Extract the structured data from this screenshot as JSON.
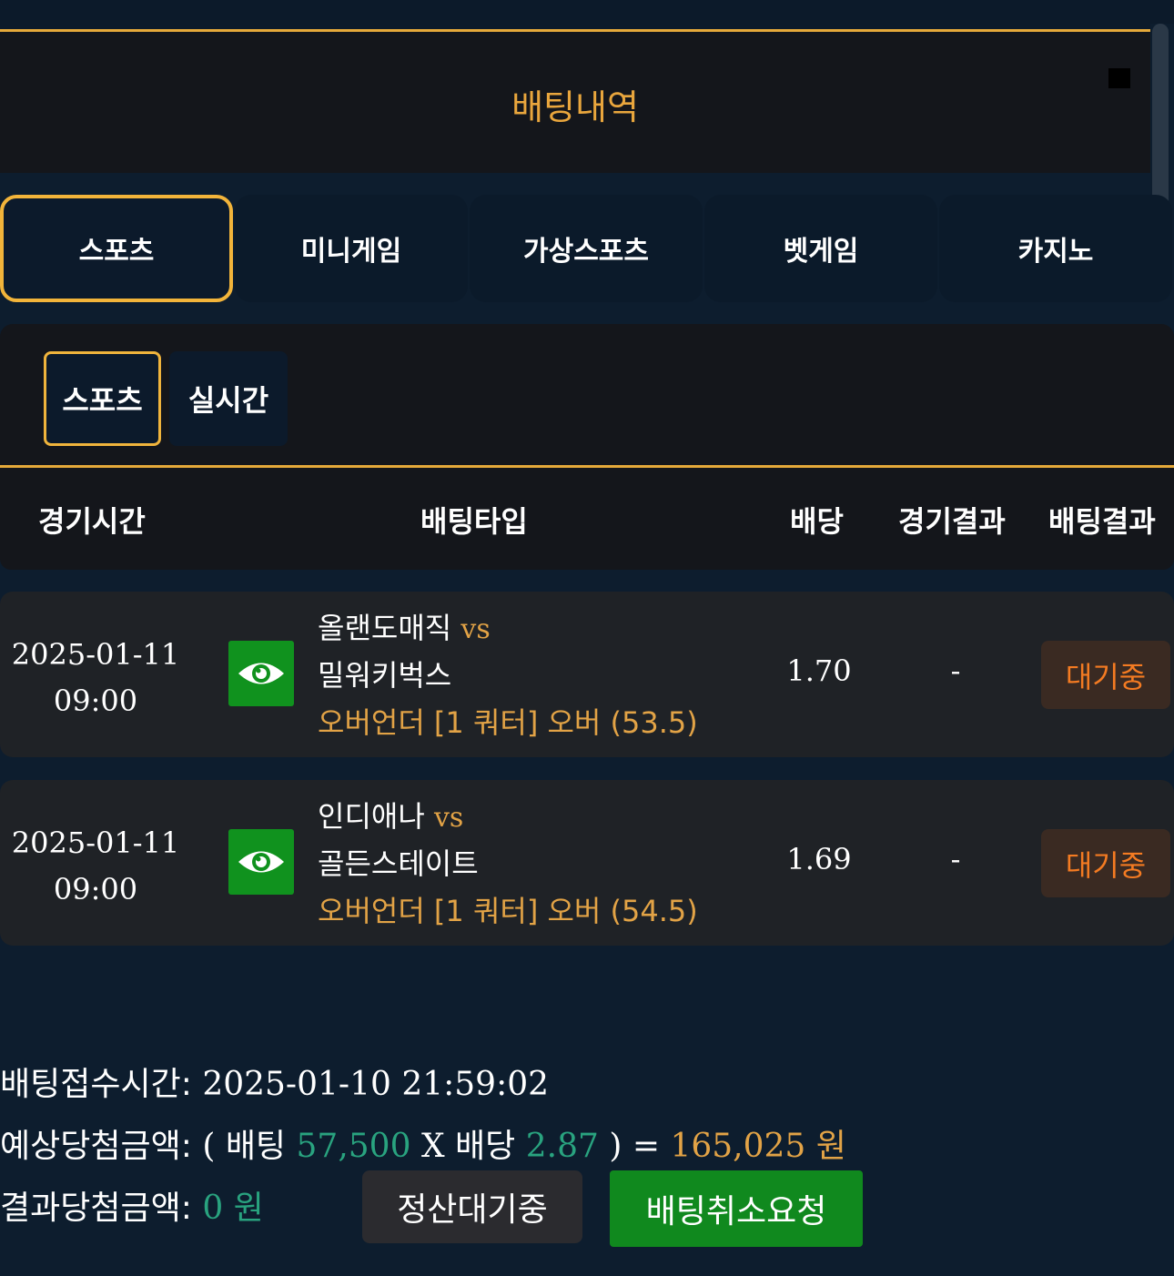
{
  "modal": {
    "title": "배팅내역"
  },
  "tabs": [
    {
      "label": "스포츠",
      "active": true
    },
    {
      "label": "미니게임",
      "active": false
    },
    {
      "label": "가상스포츠",
      "active": false
    },
    {
      "label": "벳게임",
      "active": false
    },
    {
      "label": "카지노",
      "active": false
    }
  ],
  "subtabs": [
    {
      "label": "스포츠",
      "active": true
    },
    {
      "label": "실시간",
      "active": false
    }
  ],
  "table": {
    "headers": [
      "경기시간",
      "배팅타입",
      "배당",
      "경기결과",
      "배팅결과"
    ],
    "rows": [
      {
        "date": "2025-01-11",
        "time": "09:00",
        "home": "올랜도매직",
        "vs": "vs",
        "away": "밀워키벅스",
        "bet_type": "오버언더 [1 쿼터] 오버 (53.5)",
        "odds": "1.70",
        "match_result": "-",
        "bet_result": "대기중"
      },
      {
        "date": "2025-01-11",
        "time": "09:00",
        "home": "인디애나",
        "vs": "vs",
        "away": "골든스테이트",
        "bet_type": "오버언더 [1 쿼터] 오버 (54.5)",
        "odds": "1.69",
        "match_result": "-",
        "bet_result": "대기중"
      }
    ]
  },
  "summary": {
    "received_label": "배팅접수시간:",
    "received_value": "2025-01-10 21:59:02",
    "expected_label": "예상당첨금액:",
    "open_paren": "(",
    "bet_word": "배팅",
    "bet_amount": "57,500",
    "times": "X",
    "odds_word": "배당",
    "total_odds": "2.87",
    "close_eq": ") =",
    "expected_amount": "165,025 원",
    "result_label": "결과당첨금액:",
    "result_amount": "0 원"
  },
  "buttons": {
    "pending": "정산대기중",
    "cancel": "배팅취소요청"
  },
  "colors": {
    "accent": "#e9a63d",
    "status": "#f47b22",
    "green": "#10921e",
    "teal": "#29a37f"
  },
  "icons": {
    "view": "eye-icon",
    "close": "close-icon"
  }
}
